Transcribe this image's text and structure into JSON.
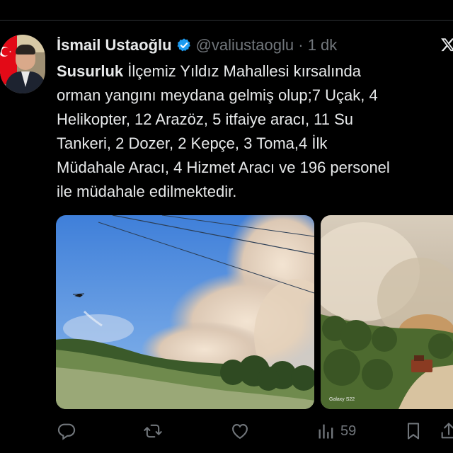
{
  "tweet": {
    "author_name": "İsmail Ustaoğlu",
    "handle": "@valiustaoglu",
    "separator": "·",
    "time": "1 dk",
    "hashtag": "Susurluk",
    "text_lines": [
      " İlçemiz Yıldız Mahallesi kırsalında",
      "orman yangını meydana gelmiş olup;7 Uçak, 4",
      "Helikopter, 12 Arazöz, 5 itfaiye aracı, 11 Su",
      "Tankeri, 2 Dozer, 2 Kepçe, 3 Toma,4 İlk",
      "Müdahale Aracı, 4 Hizmet Aracı ve 196 personel",
      "ile müdahale edilmektedir."
    ],
    "media": [
      {
        "name": "fire-photo-helicopter"
      },
      {
        "name": "fire-photo-forest-road",
        "caption": "Galaxy S22"
      }
    ],
    "stats": {
      "views": "59"
    }
  },
  "icons": {
    "verified": "verified-badge-icon",
    "brand": "x-logo-icon",
    "reply": "reply-icon",
    "retweet": "retweet-icon",
    "like": "like-icon",
    "views": "views-icon",
    "bookmark": "bookmark-icon",
    "share": "share-icon"
  },
  "colors": {
    "background": "#000000",
    "text": "#e7e9ea",
    "muted": "#71767b",
    "verified": "#1d9bf0"
  }
}
